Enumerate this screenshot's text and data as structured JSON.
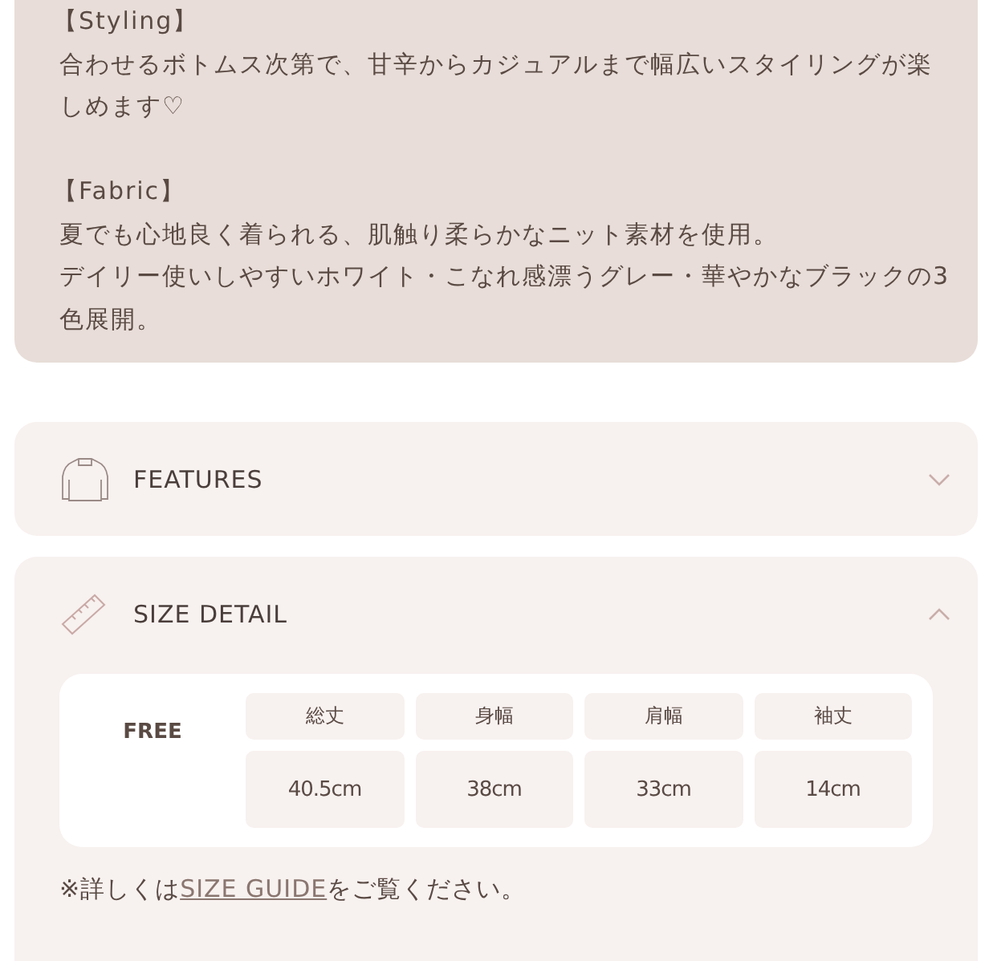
{
  "description": {
    "paragraphs": [
      {
        "heading": "【Styling】",
        "lines": [
          "合わせるボトムス次第で、甘辛からカジュアルまで幅広いスタイリングが楽しめます♡"
        ]
      },
      {
        "heading": "【Fabric】",
        "lines": [
          "夏でも心地良く着られる、肌触り柔らかなニット素材を使用。",
          "デイリー使いしやすいホワイト・こなれ感漂うグレー・華やかなブラックの3色展開。"
        ]
      }
    ]
  },
  "accordions": [
    {
      "title": "FEATURES",
      "expanded": false
    },
    {
      "title": "SIZE DETAIL",
      "expanded": true,
      "size_table": {
        "size": "FREE",
        "columns": [
          "総丈",
          "身幅",
          "肩幅",
          "袖丈"
        ],
        "values": [
          "40.5cm",
          "38cm",
          "33cm",
          "14cm"
        ]
      },
      "note": {
        "before": "※詳しくは",
        "link": "SIZE GUIDE",
        "after": "をご覧ください。"
      }
    }
  ]
}
